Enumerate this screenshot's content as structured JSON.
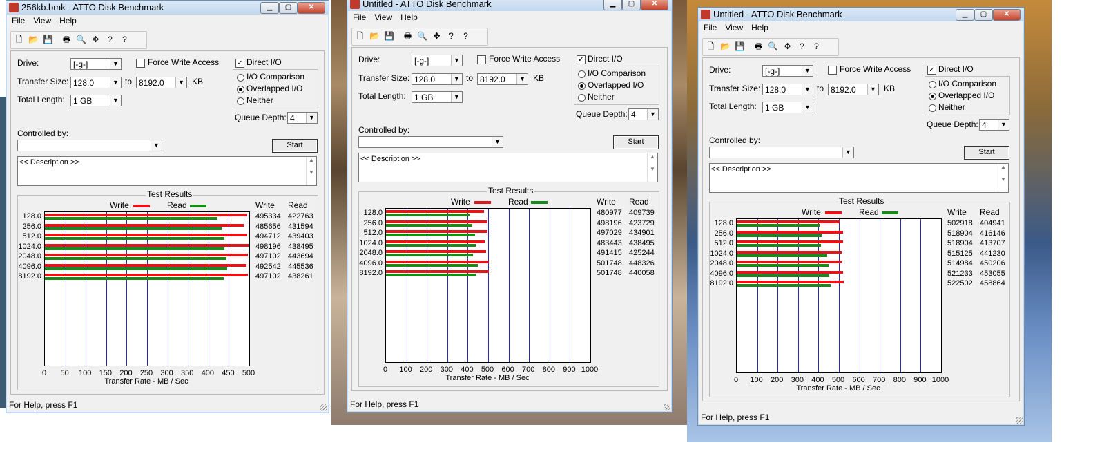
{
  "ui": {
    "menus": [
      "File",
      "View",
      "Help"
    ],
    "tools": [
      "new-icon",
      "open-icon",
      "save-icon",
      "print-icon",
      "print-preview-icon",
      "move-icon",
      "help-icon",
      "context-help-icon"
    ],
    "tool_glyphs": [
      "🗋",
      "📂",
      "💾",
      "🖶",
      "🔍",
      "✥",
      "?",
      "?"
    ],
    "drive_label": "Drive:",
    "transfer_label": "Transfer Size:",
    "to_label": "to",
    "kb_label": "KB",
    "total_label": "Total Length:",
    "force_write": "Force Write Access",
    "direct_io": "Direct I/O",
    "io_comparison": "I/O Comparison",
    "overlapped_io": "Overlapped I/O",
    "neither": "Neither",
    "queue_depth_label": "Queue Depth:",
    "controlled_by_label": "Controlled by:",
    "start_label": "Start",
    "description_text": "<< Description >>",
    "test_results_title": "Test Results",
    "write_legend": "Write",
    "read_legend": "Read",
    "col_write": "Write",
    "col_read": "Read",
    "xlabel": "Transfer Rate - MB / Sec",
    "status": "For Help, press F1",
    "write_color": "#e3141a",
    "read_color": "#1a8a1a"
  },
  "windows": [
    {
      "title": "256kb.bmk - ATTO Disk Benchmark",
      "drive": "[-g-]",
      "transfer_from": "128.0",
      "transfer_to": "8192.0",
      "total_length": "1 GB",
      "queue_depth": "4",
      "controlled_by": "",
      "force_write_access": false,
      "direct_io": true,
      "io_mode": "Overlapped I/O"
    },
    {
      "title": "Untitled - ATTO Disk Benchmark",
      "drive": "[-g-]",
      "transfer_from": "128.0",
      "transfer_to": "8192.0",
      "total_length": "1 GB",
      "queue_depth": "4",
      "controlled_by": "",
      "force_write_access": false,
      "direct_io": true,
      "io_mode": "Overlapped I/O"
    },
    {
      "title": "Untitled - ATTO Disk Benchmark",
      "drive": "[-g-]",
      "transfer_from": "128.0",
      "transfer_to": "8192.0",
      "total_length": "1 GB",
      "queue_depth": "4",
      "controlled_by": "",
      "force_write_access": false,
      "direct_io": true,
      "io_mode": "Overlapped I/O"
    }
  ],
  "chart_data": [
    {
      "type": "bar",
      "orientation": "horizontal",
      "categories": [
        "128.0",
        "256.0",
        "512.0",
        "1024.0",
        "2048.0",
        "4096.0",
        "8192.0"
      ],
      "x_ticks": [
        "0",
        "50",
        "100",
        "150",
        "200",
        "250",
        "300",
        "350",
        "400",
        "450",
        "500"
      ],
      "xlim": [
        0,
        500
      ],
      "xlabel": "Transfer Rate - MB / Sec",
      "series": [
        {
          "name": "Write",
          "values": [
            495334,
            485656,
            494712,
            498196,
            497102,
            492542,
            497102
          ]
        },
        {
          "name": "Read",
          "values": [
            422763,
            431594,
            439403,
            438495,
            443694,
            445536,
            438261
          ]
        }
      ]
    },
    {
      "type": "bar",
      "orientation": "horizontal",
      "categories": [
        "128.0",
        "256.0",
        "512.0",
        "1024.0",
        "2048.0",
        "4096.0",
        "8192.0"
      ],
      "x_ticks": [
        "0",
        "100",
        "200",
        "300",
        "400",
        "500",
        "600",
        "700",
        "800",
        "900",
        "1000"
      ],
      "xlim": [
        0,
        1000
      ],
      "xlabel": "Transfer Rate - MB / Sec",
      "series": [
        {
          "name": "Write",
          "values": [
            480977,
            498196,
            497029,
            483443,
            491415,
            501748,
            501748
          ]
        },
        {
          "name": "Read",
          "values": [
            409739,
            423729,
            434901,
            438495,
            425244,
            448326,
            440058
          ]
        }
      ]
    },
    {
      "type": "bar",
      "orientation": "horizontal",
      "categories": [
        "128.0",
        "256.0",
        "512.0",
        "1024.0",
        "2048.0",
        "4096.0",
        "8192.0"
      ],
      "x_ticks": [
        "0",
        "100",
        "200",
        "300",
        "400",
        "500",
        "600",
        "700",
        "800",
        "900",
        "1000"
      ],
      "xlim": [
        0,
        1000
      ],
      "xlabel": "Transfer Rate - MB / Sec",
      "series": [
        {
          "name": "Write",
          "values": [
            502918,
            518904,
            518904,
            515125,
            514984,
            521233,
            522502
          ]
        },
        {
          "name": "Read",
          "values": [
            404941,
            416146,
            413707,
            441230,
            450206,
            453055,
            458864
          ]
        }
      ]
    }
  ]
}
